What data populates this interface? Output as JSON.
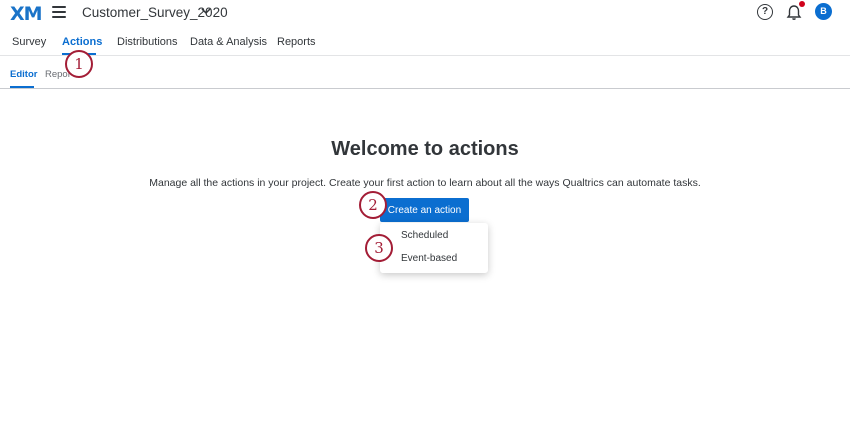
{
  "header": {
    "logo": "XM",
    "project_title": "Customer_Survey_2020",
    "avatar_initial": "B",
    "help_glyph": "?"
  },
  "nav": {
    "tabs": [
      {
        "label": "Survey"
      },
      {
        "label": "Actions",
        "active": true
      },
      {
        "label": "Distributions"
      },
      {
        "label": "Data & Analysis"
      },
      {
        "label": "Reports"
      }
    ]
  },
  "subnav": {
    "tabs": [
      {
        "label": "Editor",
        "active": true
      },
      {
        "label": "Repor"
      }
    ]
  },
  "main": {
    "title": "Welcome to actions",
    "description": "Manage all the actions in your project. Create your first action to learn about all the ways Qualtrics can automate tasks.",
    "create_button": "Create an action",
    "dropdown": {
      "items": [
        "Scheduled",
        "Event-based"
      ]
    }
  },
  "callouts": [
    "1",
    "2",
    "3"
  ],
  "colors": {
    "accent": "#0b6ed0",
    "callout": "#a31d36",
    "notification": "#d0021b"
  }
}
